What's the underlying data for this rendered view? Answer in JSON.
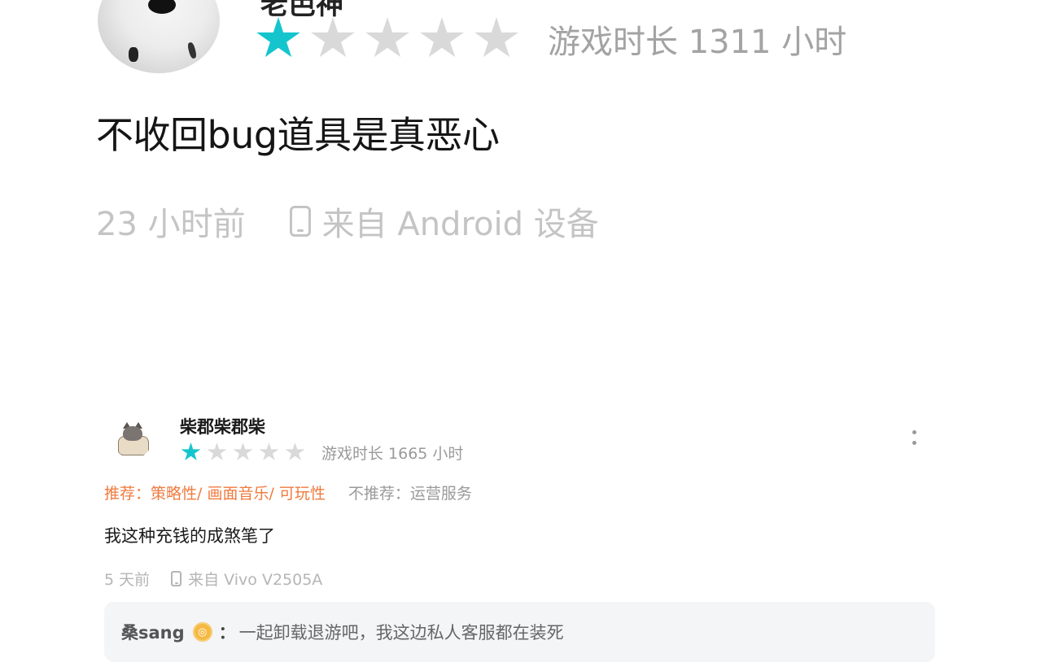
{
  "colors": {
    "star_active": "#15c5ce",
    "star_inactive": "#d9d9d9",
    "recommend_text": "#f07b3f",
    "secondary_text": "#9a9a9a",
    "reply_background": "#f3f5f7",
    "badge": "#f5b942"
  },
  "top_review": {
    "username_partial": "老芭神",
    "rating": 1,
    "max_rating": 5,
    "playtime": "游戏时长 1311 小时",
    "content": "不收回bug道具是真恶心",
    "time_ago": "23 小时前",
    "device": "来自 Android 设备",
    "device_icon": "phone-icon"
  },
  "review": {
    "username": "柴郡柴郡柴",
    "rating": 1,
    "max_rating": 5,
    "playtime": "游戏时长 1665 小时",
    "more_icon": "more-vertical-icon",
    "recommend": "推荐：策略性/ 画面音乐/ 可玩性",
    "not_recommend": "不推荐：运营服务",
    "content": "我这种充钱的成煞笔了",
    "time_ago": "5 天前",
    "device": "来自 Vivo V2505A",
    "device_icon": "phone-icon",
    "reply": {
      "author": "桑sang",
      "badge_icon": "badge-icon",
      "badge_symbol": "◎",
      "colon": "：",
      "text": "一起卸载退游吧，我这边私人客服都在装死"
    }
  }
}
